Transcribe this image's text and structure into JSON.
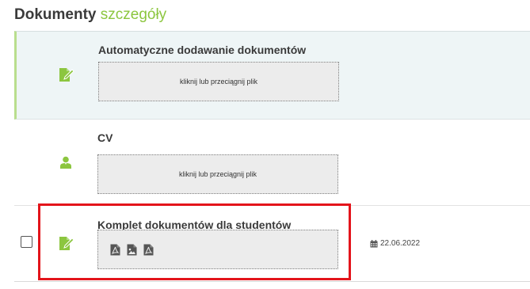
{
  "header": {
    "title": "Dokumenty",
    "subtitle": "szczegóły"
  },
  "colors": {
    "accent_green": "#8cc63f",
    "highlight_red": "#e3141b",
    "selected_row_bg": "#eef5f6"
  },
  "documents": [
    {
      "title": "Automatyczne dodawanie dokumentów",
      "icon": "document-edit-icon",
      "dropzone_text": "kliknij lub przeciągnij plik"
    },
    {
      "title": "CV",
      "icon": "user-icon",
      "dropzone_text": "kliknij lub przeciągnij plik"
    },
    {
      "title": "Komplet dokumentów dla studentów",
      "icon": "document-edit-icon",
      "files": [
        "pdf-file-icon",
        "image-file-icon",
        "pdf-file-icon"
      ],
      "date_icon": "calendar-icon",
      "date": "22.06.2022",
      "checked": false
    }
  ]
}
